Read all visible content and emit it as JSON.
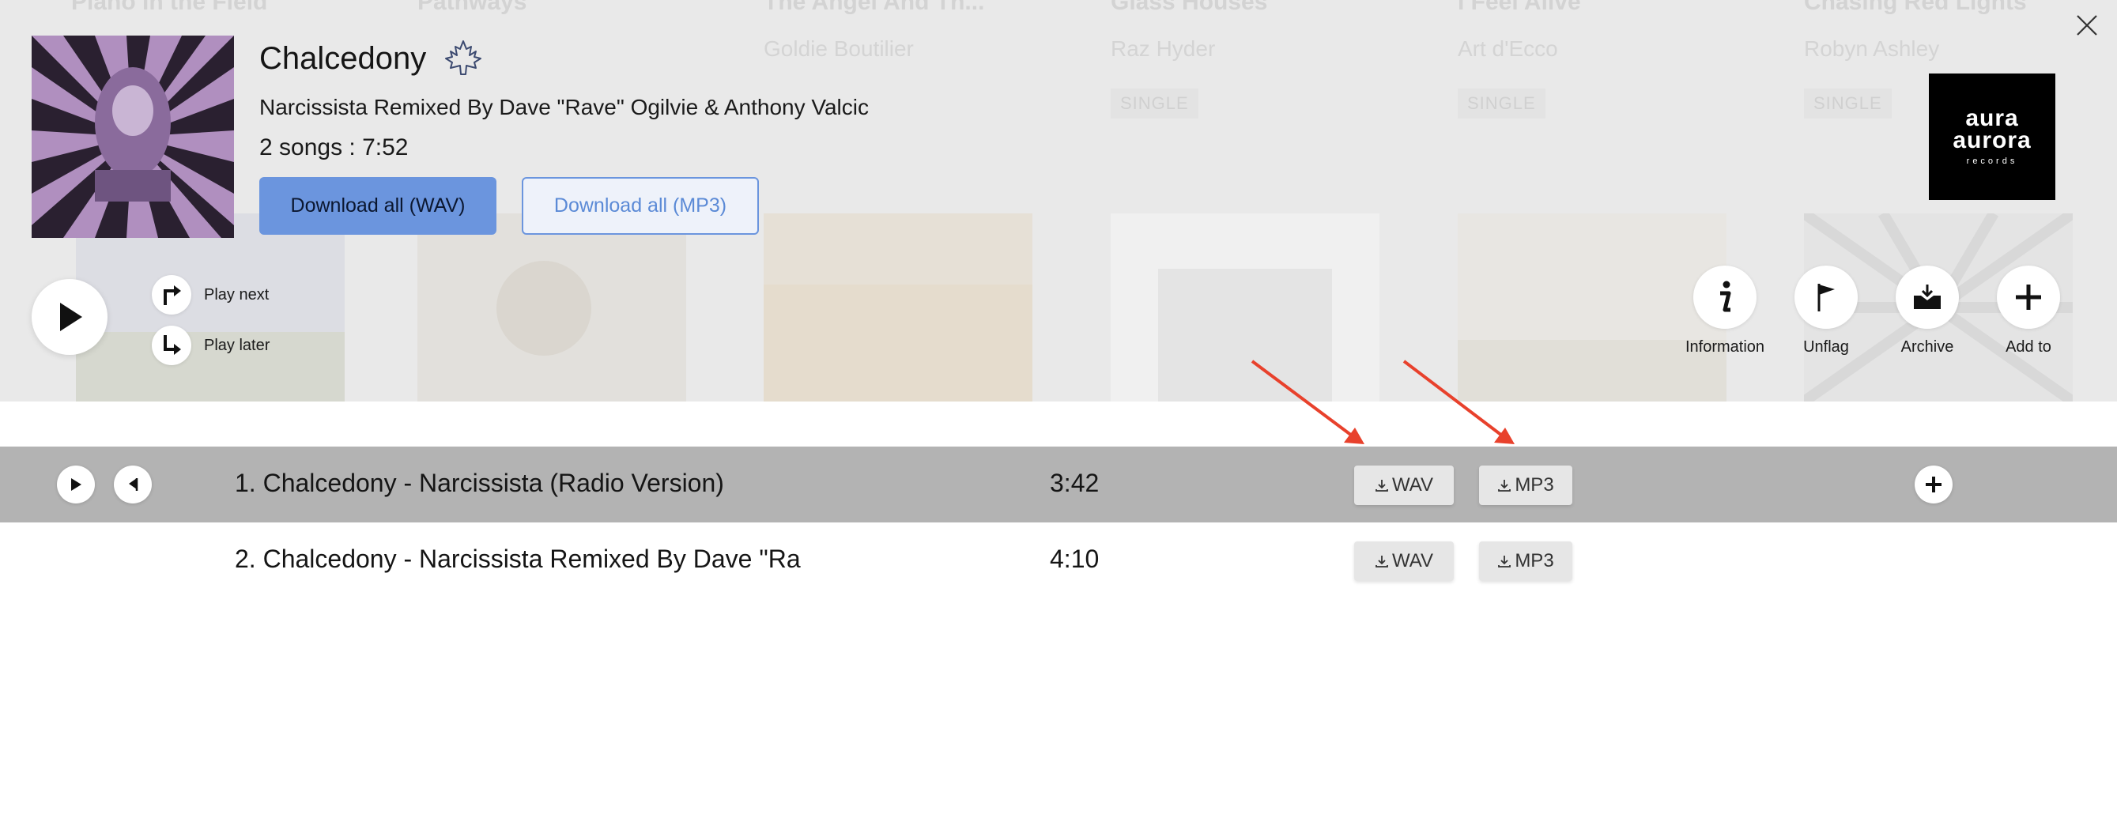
{
  "background_albums": [
    {
      "title": "Piano in the Field",
      "artist": "",
      "tag": ""
    },
    {
      "title": "Pathways",
      "artist": "",
      "tag": ""
    },
    {
      "title": "The Angel And Th...",
      "artist": "Goldie Boutilier",
      "tag": ""
    },
    {
      "title": "Glass Houses",
      "artist": "Raz Hyder",
      "tag": "SINGLE"
    },
    {
      "title": "I Feel Alive",
      "artist": "Art d'Ecco",
      "tag": "SINGLE"
    },
    {
      "title": "Chasing Red Lights",
      "artist": "Robyn Ashley",
      "tag": "SINGLE"
    }
  ],
  "album": {
    "title": "Chalcedony",
    "subtitle": "Narcissista Remixed By Dave \"Rave\" Ogilvie & Anthony Valcic",
    "meta": "2 songs : 7:52",
    "download_wav_label": "Download all (WAV)",
    "download_mp3_label": "Download all (MP3)",
    "canadian_icon": "maple-leaf-icon"
  },
  "label_logo": {
    "line1": "aura",
    "line2": "aurora",
    "line3": "records"
  },
  "queue": {
    "play_next": "Play next",
    "play_later": "Play later"
  },
  "actions": [
    {
      "label": "Information",
      "icon": "info-icon"
    },
    {
      "label": "Unflag",
      "icon": "flag-icon"
    },
    {
      "label": "Archive",
      "icon": "archive-icon"
    },
    {
      "label": "Add to",
      "icon": "plus-icon"
    }
  ],
  "tracks": [
    {
      "title": "1. Chalcedony - Narcissista (Radio Version)",
      "duration": "3:42",
      "wav": "WAV",
      "mp3": "MP3"
    },
    {
      "title": "2. Chalcedony - Narcissista Remixed By Dave \"Ra",
      "duration": "4:10",
      "wav": "WAV",
      "mp3": "MP3"
    }
  ],
  "colors": {
    "accent": "#6b95de",
    "annotation_arrow": "#e8412c",
    "active_row": "#b3b3b3"
  }
}
